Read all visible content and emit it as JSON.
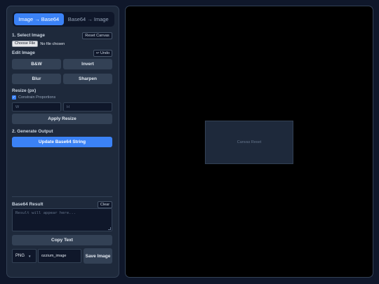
{
  "tabs": {
    "image_to_base64": "Image → Base64",
    "base64_to_image": "Base64 → Image"
  },
  "select_image": {
    "label": "1. Select Image",
    "reset_canvas": "Reset Canvas",
    "choose_file": "Choose File",
    "file_status": "No file chosen"
  },
  "edit_image": {
    "label": "Edit Image",
    "undo": "↩ Undo",
    "bw": "B&W",
    "invert": "Invert",
    "blur": "Blur",
    "sharpen": "Sharpen"
  },
  "resize": {
    "label": "Resize (px)",
    "constrain_label": "Constrain Proportions",
    "constrain_checked": true,
    "width_placeholder": "W",
    "height_placeholder": "H",
    "apply": "Apply Resize"
  },
  "generate": {
    "label": "2. Generate Output",
    "update": "Update Base64 String"
  },
  "result": {
    "label": "Base64 Result",
    "clear": "Clear",
    "placeholder": "Result will appear here...",
    "copy": "Copy Text"
  },
  "save": {
    "format": "PNG",
    "filename": "ozzium_image",
    "button": "Save Image"
  },
  "canvas": {
    "placeholder_text": "Canvas Reset"
  },
  "colors": {
    "accent": "#3b82f6",
    "panel": "#1e293b",
    "background": "#0f172a",
    "canvas": "#000000"
  }
}
